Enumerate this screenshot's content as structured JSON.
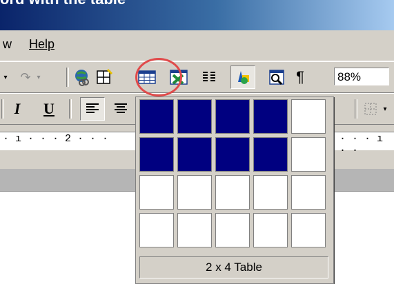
{
  "title": "ord with the table",
  "menu": {
    "items": [
      "w",
      "Help"
    ]
  },
  "toolbar": {
    "zoom": "88%",
    "pilcrow": "¶",
    "icons": [
      "dropdown-arrow-icon",
      "redo-icon",
      "dropdown-arrow-icon",
      "hyperlink-icon",
      "tables-borders-icon",
      "insert-table-icon",
      "insert-excel-icon",
      "columns-icon",
      "drawing-icon",
      "print-preview-icon"
    ]
  },
  "format": {
    "italic": "I",
    "underline": "U"
  },
  "ruler": {
    "left_text": "· ı · · · 2 · · ·",
    "right_text": "· · · ı · ·"
  },
  "table_picker": {
    "rows": 4,
    "cols": 5,
    "selected_rows": 2,
    "selected_cols": 4,
    "status": "2 x 4 Table",
    "colors": {
      "selected": "#000080",
      "unselected": "#ffffff"
    }
  }
}
